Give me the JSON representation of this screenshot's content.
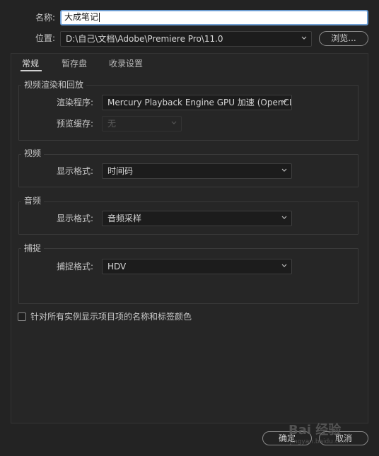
{
  "form": {
    "name_label": "名称:",
    "name_value": "大成笔记",
    "location_label": "位置:",
    "location_value": "D:\\自己\\文档\\Adobe\\Premiere Pro\\11.0",
    "browse_button": "浏览..."
  },
  "tabs": [
    {
      "label": "常规",
      "active": true
    },
    {
      "label": "暂存盘",
      "active": false
    },
    {
      "label": "收录设置",
      "active": false
    }
  ],
  "groups": {
    "render": {
      "title": "视频渲染和回放",
      "renderer_label": "渲染程序:",
      "renderer_value": "Mercury Playback Engine GPU 加速 (OpenCL)",
      "preview_cache_label": "预览缓存:",
      "preview_cache_value": "无"
    },
    "video": {
      "title": "视频",
      "display_format_label": "显示格式:",
      "display_format_value": "时间码"
    },
    "audio": {
      "title": "音频",
      "display_format_label": "显示格式:",
      "display_format_value": "音频采样"
    },
    "capture": {
      "title": "捕捉",
      "capture_format_label": "捕捉格式:",
      "capture_format_value": "HDV"
    }
  },
  "checkbox": {
    "label": "针对所有实例显示项目项的名称和标签颜色",
    "checked": false
  },
  "footer": {
    "ok_button": "确定",
    "cancel_button": "取消"
  },
  "watermark": {
    "brand": "Bai 经验",
    "url": "jingyan.baidu.com"
  },
  "colors": {
    "background": "#232323",
    "accent_focus": "#6e9ed3"
  }
}
